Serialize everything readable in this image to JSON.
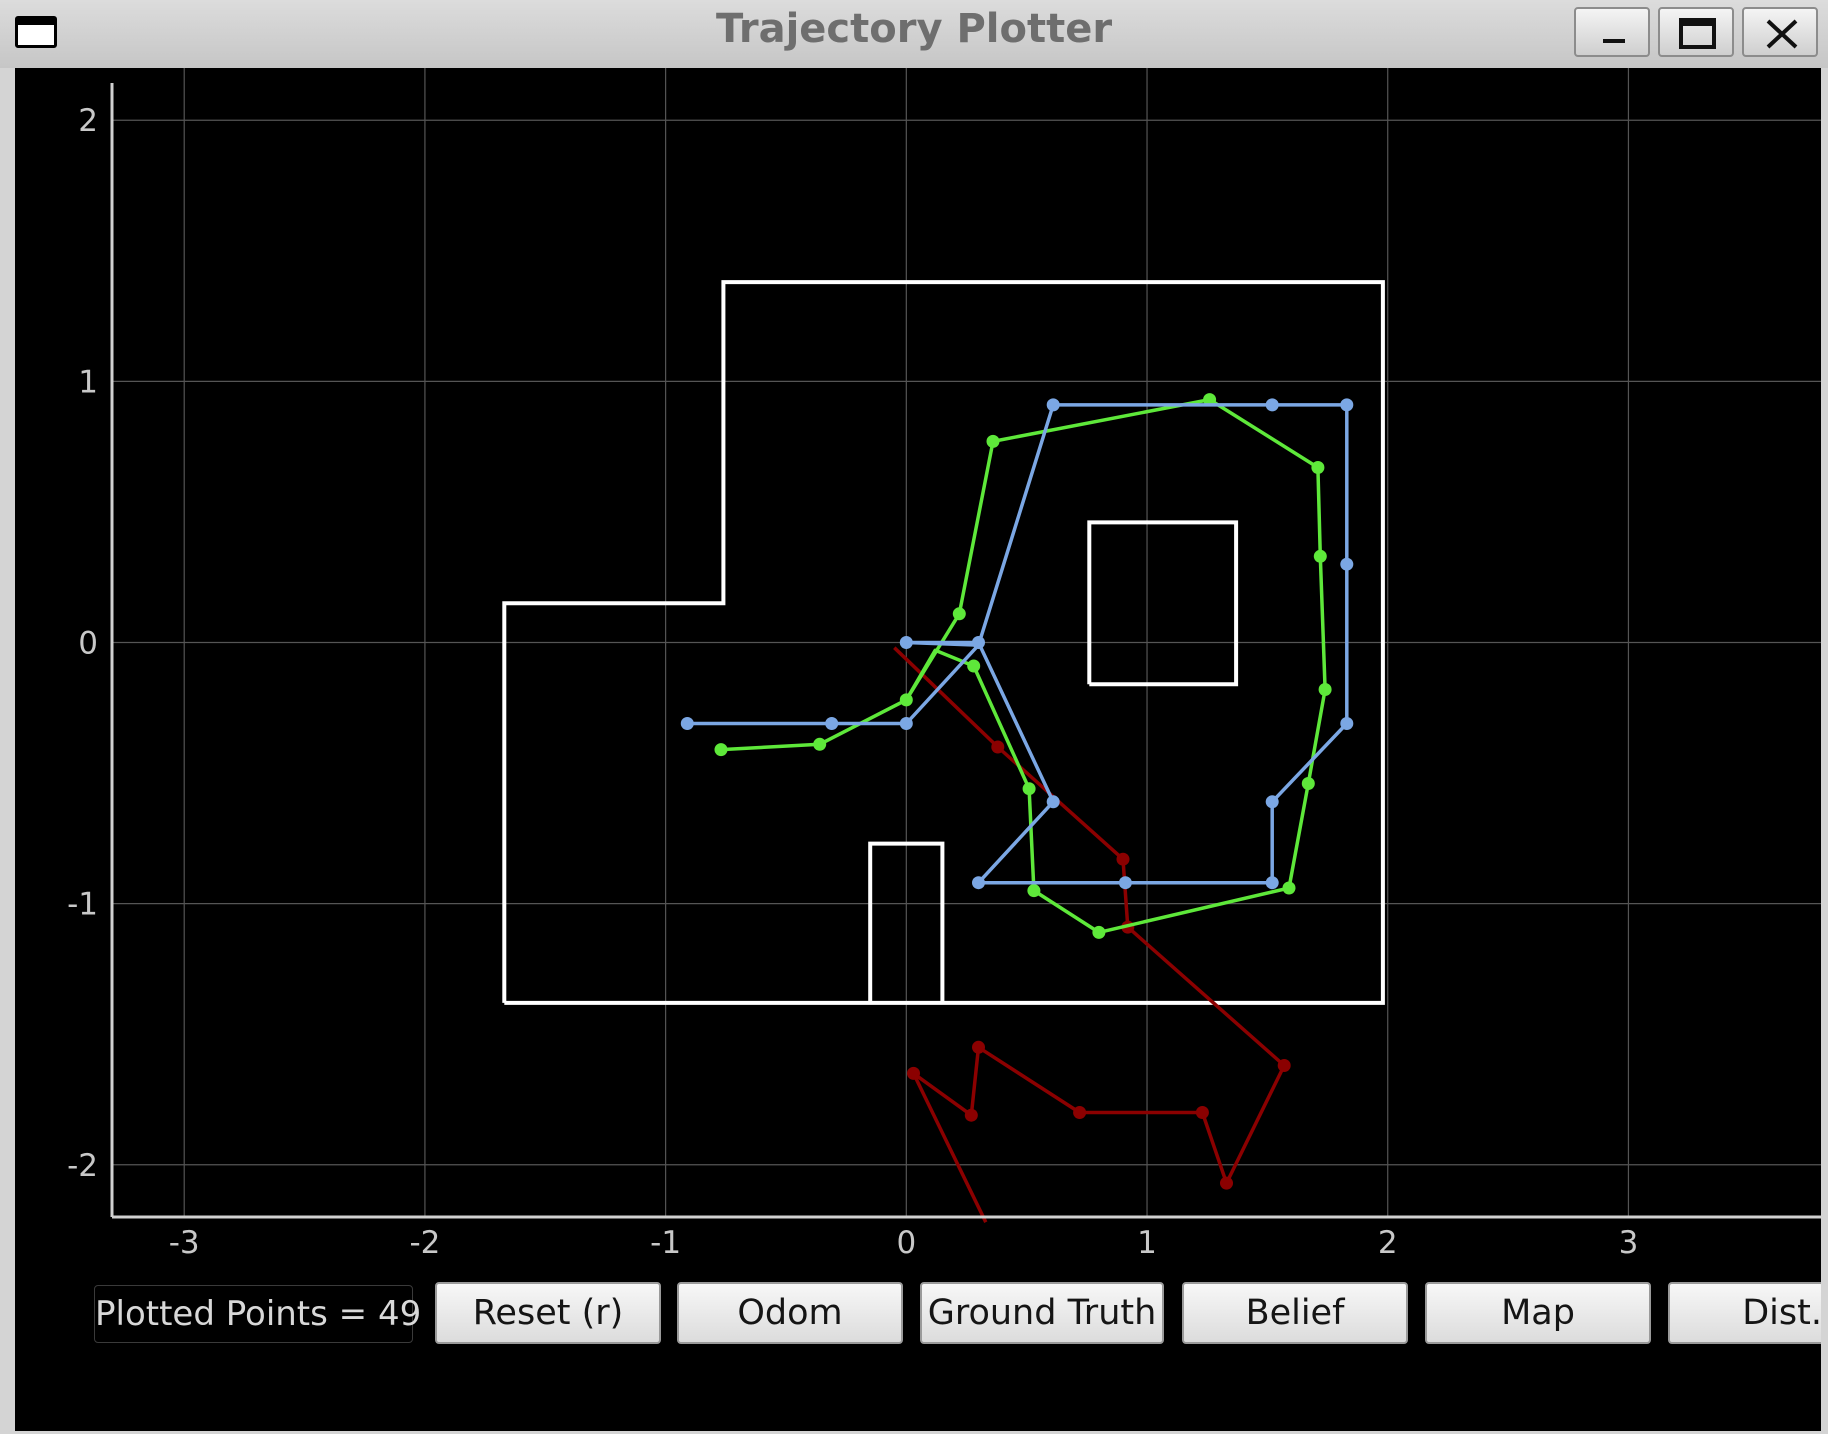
{
  "window": {
    "title": "Trajectory Plotter",
    "icons": [
      "window-menu-icon",
      "minimize-icon",
      "maximize-icon",
      "close-icon"
    ]
  },
  "status": {
    "plotted_points_label": "Plotted Points = 49"
  },
  "buttons": {
    "reset": "Reset (r)",
    "odom": "Odom",
    "ground_truth": "Ground Truth",
    "belief": "Belief",
    "map": "Map",
    "dist": "Dist."
  },
  "colors": {
    "background": "#000000",
    "grid": "#555555",
    "axis": "#d0d0d0",
    "map": "#ffffff",
    "odom": "#8b0000",
    "ground_truth": "#5ee83a",
    "belief": "#7ba7e4"
  },
  "chart_data": {
    "type": "line",
    "xlim": [
      -3.3,
      3.8
    ],
    "ylim": [
      -2.2,
      2.2
    ],
    "xticks": [
      -3,
      -2,
      -1,
      0,
      1,
      2,
      3
    ],
    "yticks": [
      -2,
      -1,
      0,
      1,
      2
    ],
    "grid": true,
    "map": {
      "outer": [
        [
          -1.67,
          -1.38
        ],
        [
          1.98,
          -1.38
        ],
        [
          1.98,
          1.38
        ],
        [
          -0.76,
          1.38
        ],
        [
          -0.76,
          0.15
        ],
        [
          -1.67,
          0.15
        ],
        [
          -1.67,
          -1.38
        ]
      ],
      "obstacles": [
        [
          [
            0.76,
            -0.16
          ],
          [
            1.37,
            -0.16
          ],
          [
            1.37,
            0.46
          ],
          [
            0.76,
            0.46
          ],
          [
            0.76,
            -0.16
          ]
        ],
        [
          [
            -0.15,
            -1.38
          ],
          [
            -0.15,
            -0.77
          ],
          [
            0.15,
            -0.77
          ],
          [
            0.15,
            -1.38
          ]
        ]
      ]
    },
    "series": [
      {
        "key": "odom",
        "points": [
          [
            -0.05,
            -0.02
          ],
          [
            0.38,
            -0.4
          ],
          [
            0.9,
            -0.83
          ],
          [
            0.92,
            -1.09
          ],
          [
            1.57,
            -1.62
          ],
          [
            1.33,
            -2.07
          ],
          [
            1.23,
            -1.8
          ],
          [
            0.72,
            -1.8
          ],
          [
            0.3,
            -1.55
          ],
          [
            0.27,
            -1.81
          ],
          [
            0.03,
            -1.65
          ],
          [
            0.33,
            -2.22
          ]
        ],
        "markers": [
          [
            0.38,
            -0.4
          ],
          [
            0.9,
            -0.83
          ],
          [
            0.92,
            -1.09
          ],
          [
            1.57,
            -1.62
          ],
          [
            1.33,
            -2.07
          ],
          [
            1.23,
            -1.8
          ],
          [
            0.72,
            -1.8
          ],
          [
            0.3,
            -1.55
          ],
          [
            0.27,
            -1.81
          ],
          [
            0.03,
            -1.65
          ]
        ]
      },
      {
        "key": "ground_truth",
        "points": [
          [
            -0.77,
            -0.41
          ],
          [
            -0.36,
            -0.39
          ],
          [
            0.0,
            -0.22
          ],
          [
            0.22,
            0.11
          ],
          [
            0.36,
            0.77
          ],
          [
            1.26,
            0.93
          ],
          [
            1.71,
            0.67
          ],
          [
            1.72,
            0.33
          ],
          [
            1.74,
            -0.18
          ],
          [
            1.67,
            -0.54
          ],
          [
            1.59,
            -0.94
          ],
          [
            0.8,
            -1.11
          ],
          [
            0.53,
            -0.95
          ],
          [
            0.51,
            -0.56
          ],
          [
            0.28,
            -0.09
          ],
          [
            0.12,
            -0.03
          ],
          [
            0.0,
            -0.22
          ]
        ],
        "markers": [
          [
            -0.77,
            -0.41
          ],
          [
            -0.36,
            -0.39
          ],
          [
            0.0,
            -0.22
          ],
          [
            0.22,
            0.11
          ],
          [
            0.36,
            0.77
          ],
          [
            1.26,
            0.93
          ],
          [
            1.71,
            0.67
          ],
          [
            1.72,
            0.33
          ],
          [
            1.74,
            -0.18
          ],
          [
            1.67,
            -0.54
          ],
          [
            1.59,
            -0.94
          ],
          [
            0.8,
            -1.11
          ],
          [
            0.53,
            -0.95
          ],
          [
            0.51,
            -0.56
          ],
          [
            0.28,
            -0.09
          ]
        ]
      },
      {
        "key": "belief",
        "points": [
          [
            -0.91,
            -0.31
          ],
          [
            -0.31,
            -0.31
          ],
          [
            0.0,
            -0.31
          ],
          [
            0.3,
            -0.01
          ],
          [
            0.0,
            0.0
          ],
          [
            0.3,
            0.0
          ],
          [
            0.61,
            -0.61
          ],
          [
            0.3,
            -0.92
          ],
          [
            0.91,
            -0.92
          ],
          [
            1.52,
            -0.92
          ],
          [
            1.52,
            -0.61
          ],
          [
            1.83,
            -0.31
          ],
          [
            1.83,
            0.3
          ],
          [
            1.83,
            0.91
          ],
          [
            1.52,
            0.91
          ],
          [
            0.61,
            0.91
          ],
          [
            0.3,
            -0.01
          ],
          [
            0.0,
            -0.31
          ]
        ],
        "markers": [
          [
            -0.91,
            -0.31
          ],
          [
            -0.31,
            -0.31
          ],
          [
            0.0,
            -0.31
          ],
          [
            0.0,
            0.0
          ],
          [
            0.3,
            0.0
          ],
          [
            0.61,
            -0.61
          ],
          [
            0.3,
            -0.92
          ],
          [
            0.91,
            -0.92
          ],
          [
            1.52,
            -0.92
          ],
          [
            1.52,
            -0.61
          ],
          [
            1.83,
            -0.31
          ],
          [
            1.83,
            0.3
          ],
          [
            1.83,
            0.91
          ],
          [
            1.52,
            0.91
          ],
          [
            0.61,
            0.91
          ]
        ]
      }
    ]
  }
}
